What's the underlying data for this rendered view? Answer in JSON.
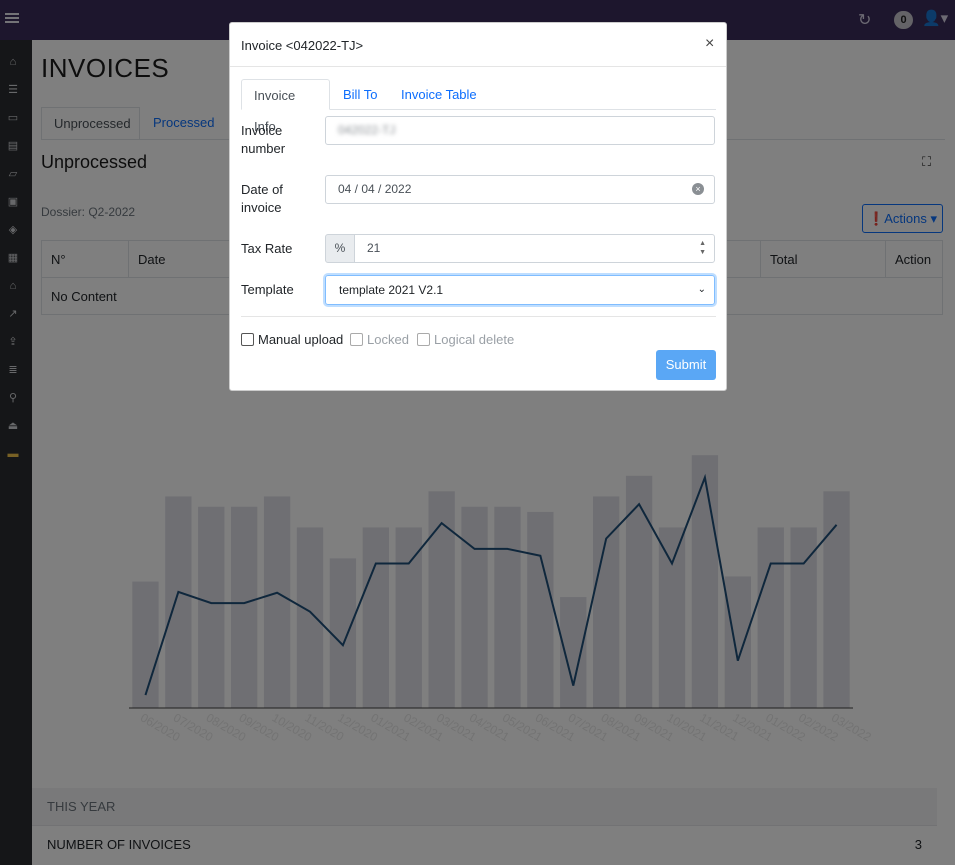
{
  "topbar": {
    "notification_count": "0"
  },
  "page": {
    "title": "INVOICES",
    "tabs": [
      {
        "label": "Unprocessed"
      },
      {
        "label": "Processed"
      }
    ],
    "section_title": "Unprocessed",
    "dossier": "Dossier: Q2-2022",
    "actions_label": "Actions",
    "table": {
      "headers": [
        "N°",
        "Date",
        "Total",
        "Action"
      ],
      "empty_text": "No Content"
    },
    "year_panel": {
      "header": "THIS YEAR",
      "row_label": "NUMBER OF INVOICES",
      "row_value": "3"
    }
  },
  "chart_data": {
    "type": "bar",
    "categories": [
      "06/2020",
      "07/2020",
      "08/2020",
      "09/2020",
      "10/2020",
      "11/2020",
      "12/2020",
      "01/2021",
      "02/2021",
      "03/2021",
      "04/2021",
      "05/2021",
      "06/2021",
      "07/2021",
      "08/2021",
      "09/2021",
      "10/2021",
      "11/2021",
      "12/2021",
      "01/2022",
      "02/2022",
      "03/2022"
    ],
    "series": [
      {
        "type": "bar",
        "values": [
          24.5,
          41,
          39,
          39,
          41,
          35,
          29,
          35,
          35,
          42,
          39,
          39,
          38,
          21.5,
          41,
          45,
          35,
          49,
          25.5,
          35,
          35,
          42
        ]
      },
      {
        "type": "line",
        "values": [
          1.5,
          13.5,
          12.2,
          12.2,
          13.4,
          11.2,
          7.3,
          16.8,
          16.8,
          21.5,
          18.5,
          18.5,
          17.7,
          2.6,
          19.7,
          23.7,
          16.8,
          26.8,
          5.5,
          16.8,
          16.8,
          21.3
        ]
      }
    ],
    "colors": {
      "bar": "#dedee6",
      "line": "#1f4e79"
    }
  },
  "modal": {
    "title": "Invoice <042022-TJ>",
    "close_symbol": "×",
    "tabs": [
      {
        "label": "Invoice Info"
      },
      {
        "label": "Bill To"
      },
      {
        "label": "Invoice Table"
      }
    ],
    "fields": {
      "invoice_number_label": "Invoice number",
      "invoice_number_value": "042022-TJ",
      "date_label": "Date of invoice",
      "date_value": "04 / 04 / 2022",
      "tax_label": "Tax Rate",
      "tax_prefix": "%",
      "tax_value": "21",
      "template_label": "Template",
      "template_value": "template 2021 V2.1"
    },
    "checkboxes": [
      {
        "label": "Manual upload",
        "checked": false,
        "disabled": false
      },
      {
        "label": "Locked",
        "checked": false,
        "disabled": true
      },
      {
        "label": "Logical delete",
        "checked": false,
        "disabled": true
      }
    ],
    "submit_label": "Submit"
  }
}
